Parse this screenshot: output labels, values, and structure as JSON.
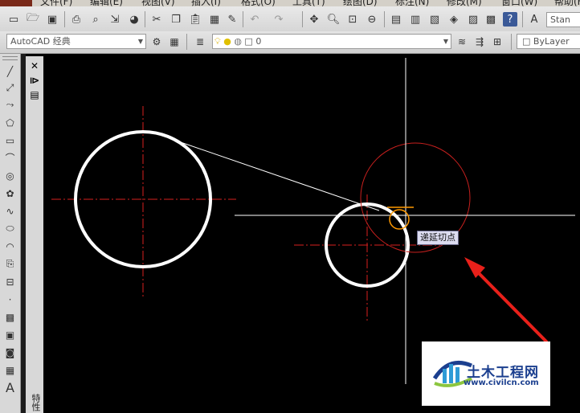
{
  "menubar": {
    "items": [
      "文件(F)",
      "编辑(E)",
      "视图(V)",
      "插入(I)",
      "格式(O)",
      "工具(T)",
      "绘图(D)",
      "标注(N)",
      "修改(M)",
      "窗口(W)",
      "帮助(H)"
    ]
  },
  "toolbar1": {
    "text_style_value": "Stan"
  },
  "toolbar2": {
    "workspace_value": "AutoCAD 经典",
    "layer_value": "0",
    "color_value": "ByLayer"
  },
  "left_panel": {
    "vertical_label": "特性"
  },
  "drawing": {
    "tooltip_text": "递延切点",
    "colors": {
      "background": "#000000",
      "circle": "#ffffff",
      "centerline": "#d8201e",
      "crosshair": "#ffffff",
      "tangent_circle": "#c8201e",
      "marker": "#ff9900",
      "arrow": "#e8201a"
    }
  },
  "watermark": {
    "title": "土木工程网",
    "url": "www.civilcn.com"
  }
}
